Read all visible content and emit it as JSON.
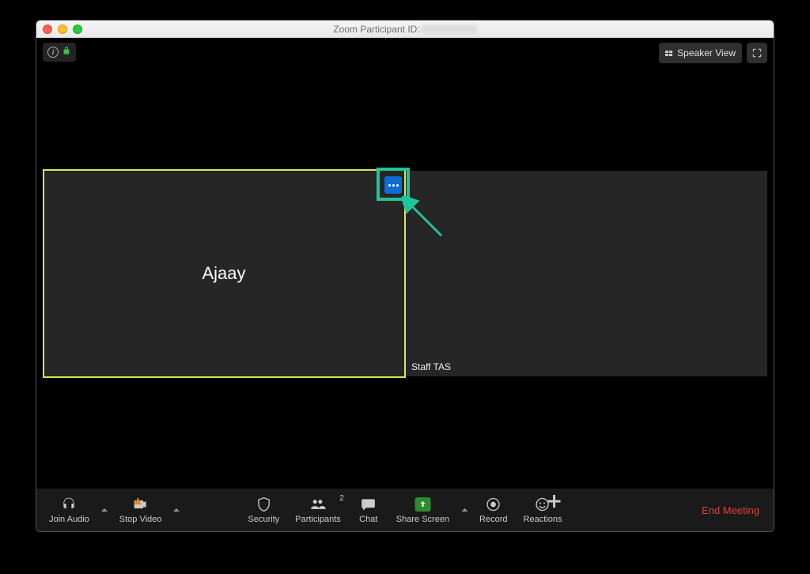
{
  "window": {
    "title_prefix": "Zoom Participant ID:"
  },
  "top": {
    "speaker_view_label": "Speaker View"
  },
  "participants": {
    "left_name": "Ajaay",
    "right_name": "Staff TAS"
  },
  "toolbar": {
    "join_audio": "Join Audio",
    "stop_video": "Stop Video",
    "security": "Security",
    "participants": "Participants",
    "participants_count": "2",
    "chat": "Chat",
    "share_screen": "Share Screen",
    "record": "Record",
    "reactions": "Reactions",
    "end_meeting": "End Meeting"
  }
}
